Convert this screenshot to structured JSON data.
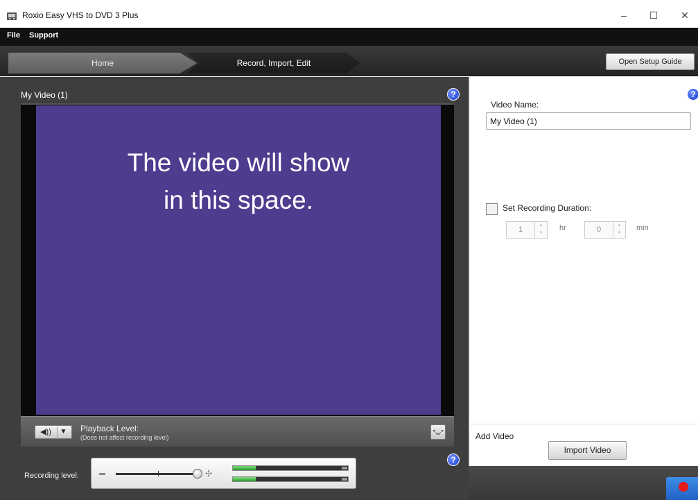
{
  "window": {
    "title": "Roxio Easy VHS to DVD 3 Plus",
    "controls": {
      "minimize": "–",
      "maximize": "☐",
      "close": "✕"
    }
  },
  "menu": {
    "items": [
      "File",
      "Support"
    ]
  },
  "breadcrumb": {
    "home": "Home",
    "current": "Record, Import, Edit"
  },
  "toolbar": {
    "setup_guide": "Open Setup Guide"
  },
  "video": {
    "title": "My Video (1)",
    "placeholder_line1": "The video will show",
    "placeholder_line2": "in this space.",
    "surface_color": "#4e3c8f"
  },
  "playback": {
    "label": "Playback Level:",
    "note": "(Does not affect recording level)"
  },
  "recording": {
    "label": "Recording level:"
  },
  "settings": {
    "video_name_label": "Video Name:",
    "video_name_value": "My Video (1)",
    "duration_label": "Set Recording Duration:",
    "duration_checked": false,
    "hours_value": "1",
    "hours_unit": "hr",
    "minutes_value": "0",
    "minutes_unit": "min"
  },
  "add_video": {
    "label": "Add Video",
    "import_button": "Import Video"
  },
  "colors": {
    "accent_blue": "#1f62c4",
    "record_red": "#e81a1a",
    "dark_panel": "#3e3e3e"
  }
}
